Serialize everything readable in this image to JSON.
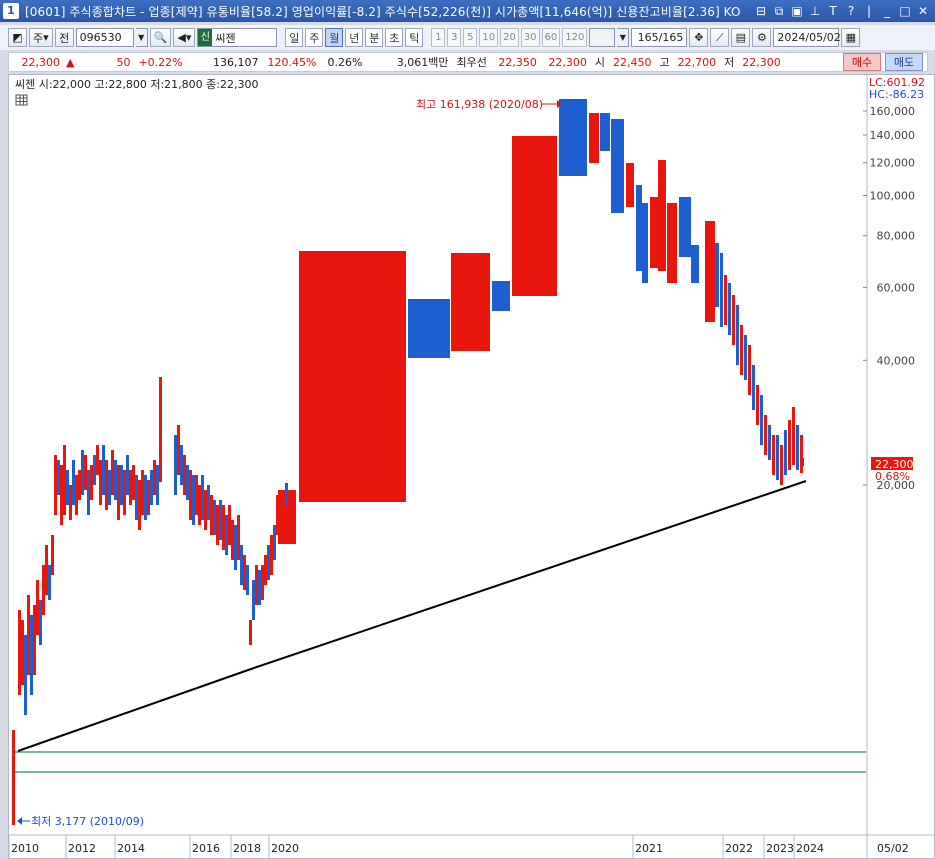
{
  "window": {
    "number": "1",
    "title": "[0601] 주식종합차트 - 업종[제약] 유통비율[58.2] 영업이익률[-8.2] 주식수[52,226(천)] 시가총액[11,646(억)] 신용잔고비율[2.36] KO"
  },
  "toolbar": {
    "type_label": "주",
    "all_label": "전",
    "code_value": "096530",
    "stock_badge": "신",
    "stock_name": "씨젠",
    "periods": [
      "일",
      "주",
      "월",
      "년",
      "분",
      "초",
      "틱"
    ],
    "active_period": "월",
    "intervals": [
      "1",
      "3",
      "5",
      "10",
      "20",
      "30",
      "60",
      "120"
    ],
    "count_value": "165",
    "count_total": "/165",
    "date_value": "2024/05/02"
  },
  "quote": {
    "price": "22,300",
    "arrow": "▲",
    "change": "50",
    "change_pct": "+0.22%",
    "volume": "136,107",
    "turnover_pct": "120.45%",
    "ratio_pct": "0.26%",
    "amount": "3,061백만",
    "best_bid_label": "최우선",
    "best_ask": "22,350",
    "best_bid": "22,300",
    "open_label": "시",
    "open": "22,450",
    "high_label": "고",
    "high": "22,700",
    "low_label": "저",
    "low": "22,300",
    "buy_label": "매수",
    "sell_label": "매도"
  },
  "chart": {
    "legend": "씨젠 시:22,000 고:22,800 저:21,800 종:22,300",
    "lc_label": "LC:601.92",
    "hc_label": "HC:-86.23",
    "high_marker": "최고 161,938 (2020/08)",
    "low_marker": "최저 3,177 (2010/09)",
    "price_tag": "22,300",
    "price_tag_pct": "0.68%",
    "date_end_label": "05/02",
    "y_ticks": [
      "160,000",
      "140,000",
      "120,000",
      "100,000",
      "80,000",
      "60,000",
      "40,000",
      "20,000"
    ],
    "x_ticks": [
      "2010",
      "2012",
      "2014",
      "2016",
      "2018",
      "2020",
      "2021",
      "2022",
      "2023",
      "2024"
    ],
    "colors": {
      "up": "#e8160c",
      "down": "#1d5fd0",
      "trend": "#000000",
      "guide": "#2e8b57"
    }
  },
  "chart_data": {
    "type": "candlestick",
    "title": "",
    "y_scale": "log",
    "series": [
      {
        "values": [
          {
            "period": "2010-09",
            "open": 3200,
            "high": 3400,
            "low": 3177,
            "close": 3300
          },
          {
            "period": "2011",
            "open": 5000,
            "high": 13000,
            "low": 5000,
            "close": 12000
          },
          {
            "period": "2012",
            "open": 14000,
            "high": 30000,
            "low": 13000,
            "close": 27000
          },
          {
            "period": "2013",
            "open": 27000,
            "high": 30000,
            "low": 19000,
            "close": 22000
          },
          {
            "period": "2014",
            "open": 22000,
            "high": 36000,
            "low": 20000,
            "close": 35000
          },
          {
            "period": "2016",
            "open": 22000,
            "high": 24000,
            "low": 18000,
            "close": 19000
          },
          {
            "period": "2018-10",
            "open": 14000,
            "high": 15000,
            "low": 10500,
            "close": 12000
          },
          {
            "period": "2019-12",
            "open": 17000,
            "high": 21000,
            "low": 16500,
            "close": 20500
          },
          {
            "period": "2020-03",
            "open": 20000,
            "high": 70000,
            "low": 20000,
            "close": 70000
          },
          {
            "period": "2020-04",
            "open": 55000,
            "high": 55000,
            "low": 40000,
            "close": 40000
          },
          {
            "period": "2020-05",
            "open": 41000,
            "high": 68000,
            "low": 41000,
            "close": 68000
          },
          {
            "period": "2020-07",
            "open": 55000,
            "high": 130000,
            "low": 55000,
            "close": 130000
          },
          {
            "period": "2020-08",
            "open": 161938,
            "high": 161938,
            "low": 105000,
            "close": 105000
          },
          {
            "period": "2021",
            "open": 110000,
            "high": 145000,
            "low": 60000,
            "close": 60000
          },
          {
            "period": "2022",
            "open": 60000,
            "high": 65000,
            "low": 22000,
            "close": 25000
          },
          {
            "period": "2023",
            "open": 26000,
            "high": 28000,
            "low": 19500,
            "close": 21500
          },
          {
            "period": "2024-05",
            "open": 22000,
            "high": 22800,
            "low": 21800,
            "close": 22300
          }
        ]
      }
    ],
    "ylim": [
      3000,
      170000
    ],
    "high_label": "161,938",
    "low_label": "3,177"
  }
}
